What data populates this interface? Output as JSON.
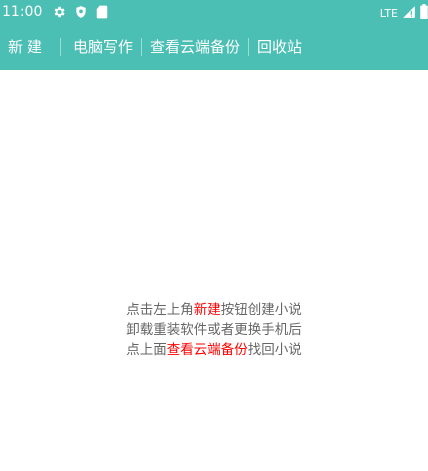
{
  "status_bar": {
    "time": "11:00",
    "network": "LTE",
    "icons_left": [
      "gear-icon",
      "shield-icon",
      "sd-card-icon"
    ],
    "icons_right": [
      "signal-icon",
      "battery-icon"
    ]
  },
  "toolbar": {
    "background": "#4cbfb5",
    "new_label": "新建",
    "pc_writing_label": "电脑写作",
    "cloud_backup_label": "查看云端备份",
    "recycle_label": "回收站"
  },
  "empty_hint": {
    "line1_pre": "点击左上角",
    "line1_hl": "新建",
    "line1_post": "按钮创建小说",
    "line2": "卸载重装软件或者更换手机后",
    "line3_pre": "点上面",
    "line3_hl": "查看云端备份",
    "line3_post": "找回小说",
    "highlight_color": "#ff0000"
  }
}
